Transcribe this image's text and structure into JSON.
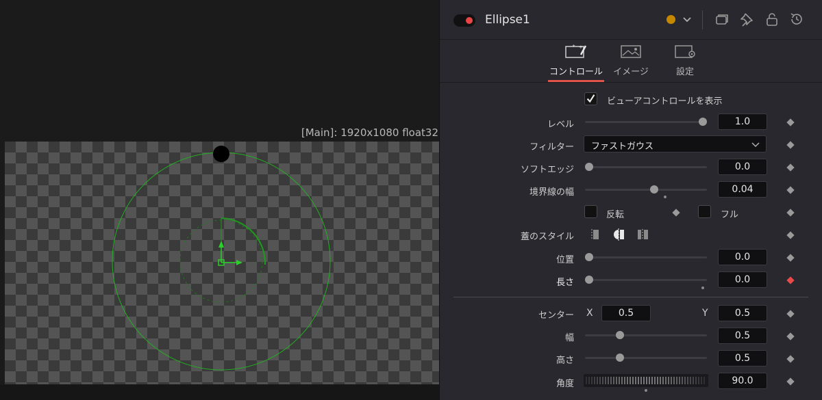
{
  "viewer": {
    "label": "[Main]: 1920x1080 float32"
  },
  "inspector": {
    "node_name": "Ellipse1",
    "node_color": "#c48800",
    "icons": [
      "color-dot",
      "chevron-down-icon",
      "versions-icon",
      "pin-icon",
      "lock-icon",
      "reset-icon"
    ]
  },
  "tabs": [
    {
      "label": "コントロール",
      "icon": "controls-icon",
      "active": true
    },
    {
      "label": "イメージ",
      "icon": "image-icon",
      "active": false
    },
    {
      "label": "設定",
      "icon": "settings-icon",
      "active": false
    }
  ],
  "controls": {
    "show_view_controls": {
      "label": "ビューアコントロールを表示",
      "checked": true
    },
    "level": {
      "label": "レベル",
      "value": "1.0",
      "fraction": 1.0
    },
    "filter": {
      "label": "フィルター",
      "value": "ファストガウス"
    },
    "soft_edge": {
      "label": "ソフトエッジ",
      "value": "0.0",
      "fraction": 0.0
    },
    "border_width": {
      "label": "境界線の幅",
      "value": "0.04",
      "fraction": 0.57
    },
    "invert": {
      "label": "反転",
      "checked": false
    },
    "solid": {
      "label": "フル",
      "checked": false
    },
    "cap_style": {
      "label": "蓋のスタイル"
    },
    "position": {
      "label": "位置",
      "value": "0.0",
      "fraction": 0.0
    },
    "length": {
      "label": "長さ",
      "value": "0.0",
      "fraction": 0.0
    },
    "center": {
      "label": "センター",
      "x_label": "X",
      "x_value": "0.5",
      "y_label": "Y",
      "y_value": "0.5"
    },
    "width": {
      "label": "幅",
      "value": "0.5",
      "fraction": 0.27
    },
    "height": {
      "label": "高さ",
      "value": "0.5",
      "fraction": 0.27
    },
    "angle": {
      "label": "角度",
      "value": "90.0"
    }
  },
  "colors": {
    "accent": "#e25449",
    "overlay_green": "#22b022",
    "keyframe_active": "#e84a4a"
  }
}
